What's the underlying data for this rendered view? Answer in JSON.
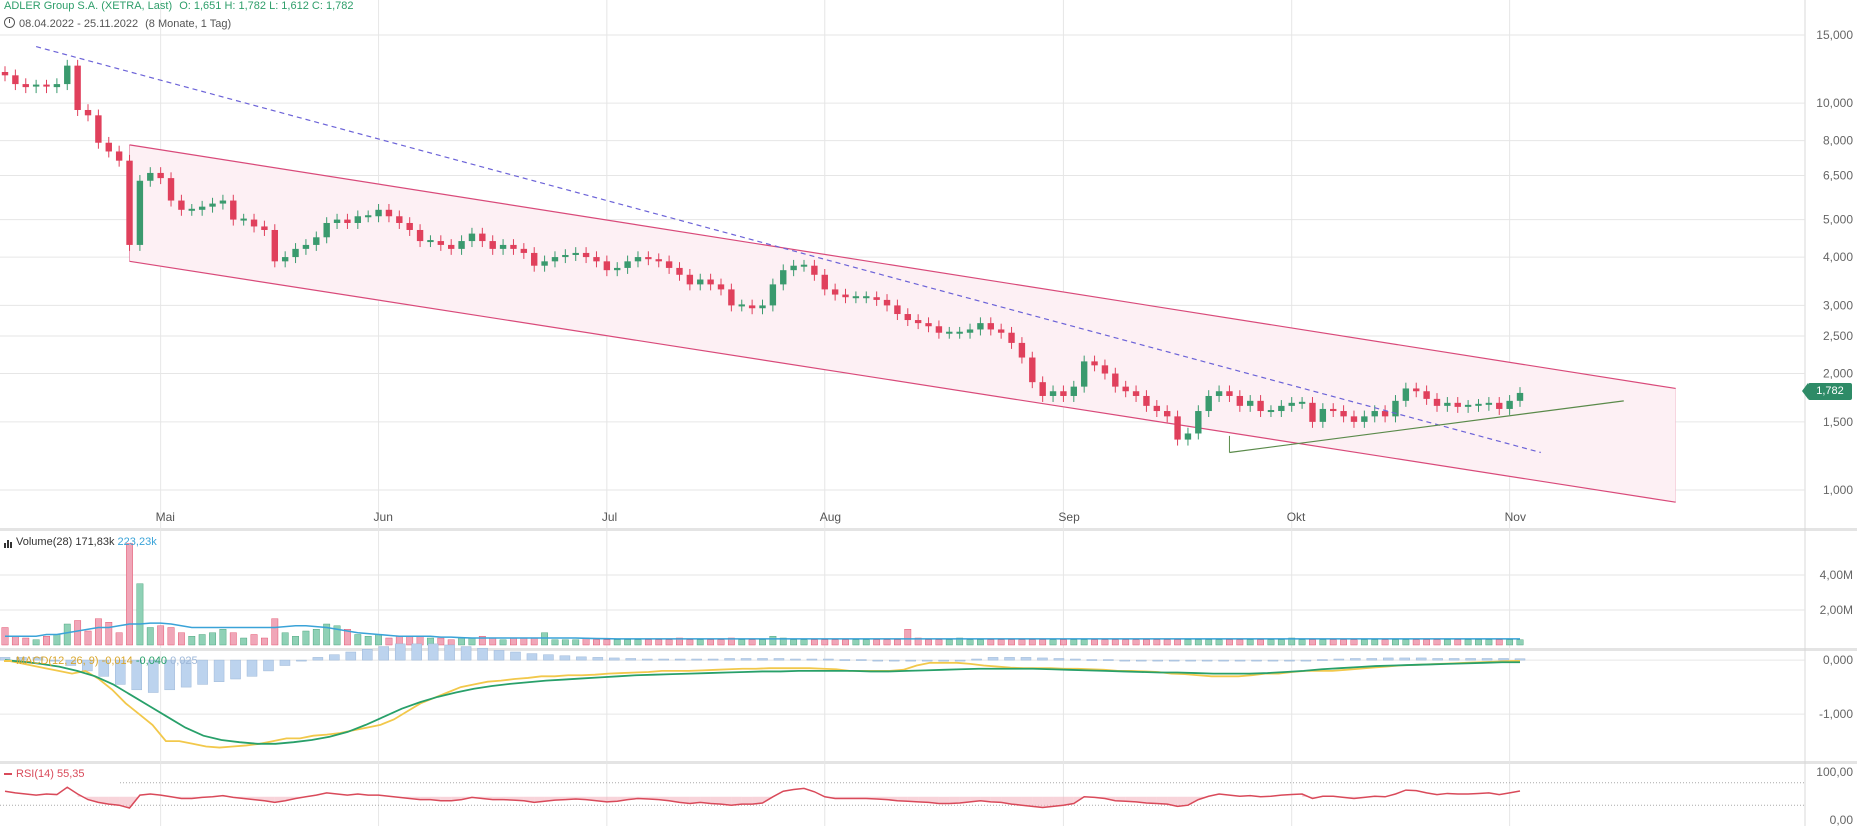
{
  "header": {
    "title": "ADLER Group S.A. (XETRA, Last)",
    "ohlc": "O: 1,651  H: 1,782  L: 1,612  C: 1,782",
    "range": "08.04.2022 - 25.11.2022",
    "duration": "(8 Monate, 1 Tag)"
  },
  "last_price_label": "1,782",
  "panels": {
    "volume": {
      "label": "Volume(28)",
      "v1": "171,83k",
      "v2": "223,23k",
      "ticks": [
        "4,00M",
        "2,00M"
      ]
    },
    "macd": {
      "label": "MACD(12, 26, 9)",
      "v1": "-0,014",
      "v2": "-0,040",
      "v3": "0,025",
      "ticks": [
        "0,000",
        "-1,000"
      ]
    },
    "rsi": {
      "label": "RSI(14)",
      "v1": "55,35",
      "ticks": [
        "100,00",
        "0,00"
      ]
    }
  },
  "chart_data": {
    "type": "candlestick",
    "scale": "log",
    "price_ticks": [
      15,
      10,
      8,
      6.5,
      5,
      4,
      3,
      2.5,
      2,
      1.5,
      1
    ],
    "price_tick_labels": [
      "15,000",
      "10,000",
      "8,000",
      "6,500",
      "5,000",
      "4,000",
      "3,000",
      "2,500",
      "2,000",
      "1,500",
      "1,000"
    ],
    "months": [
      "Mai",
      "Jun",
      "Jul",
      "Aug",
      "Sep",
      "Okt",
      "Nov"
    ],
    "month_start_index": [
      15,
      36,
      58,
      79,
      102,
      124,
      145
    ],
    "close": [
      11.8,
      11.2,
      11.0,
      11.1,
      11.0,
      11.2,
      12.5,
      9.6,
      9.3,
      7.9,
      7.5,
      7.1,
      4.3,
      6.3,
      6.6,
      6.4,
      5.6,
      5.3,
      5.3,
      5.4,
      5.5,
      5.6,
      5.0,
      5.0,
      4.8,
      4.7,
      3.9,
      4.0,
      4.2,
      4.3,
      4.5,
      4.9,
      5.0,
      4.9,
      5.1,
      5.1,
      5.3,
      5.1,
      4.9,
      4.7,
      4.4,
      4.4,
      4.3,
      4.2,
      4.4,
      4.6,
      4.4,
      4.2,
      4.3,
      4.2,
      4.1,
      3.8,
      3.9,
      4.0,
      4.05,
      4.1,
      4.0,
      3.9,
      3.7,
      3.75,
      3.9,
      4.0,
      3.95,
      3.9,
      3.75,
      3.6,
      3.4,
      3.5,
      3.4,
      3.3,
      3.0,
      3.0,
      2.95,
      3.0,
      3.4,
      3.7,
      3.8,
      3.8,
      3.6,
      3.3,
      3.2,
      3.15,
      3.15,
      3.15,
      3.1,
      3.0,
      2.85,
      2.75,
      2.7,
      2.65,
      2.55,
      2.55,
      2.55,
      2.6,
      2.7,
      2.6,
      2.55,
      2.4,
      2.2,
      1.9,
      1.75,
      1.8,
      1.75,
      1.85,
      2.15,
      2.1,
      2.0,
      1.85,
      1.8,
      1.75,
      1.65,
      1.6,
      1.55,
      1.35,
      1.4,
      1.6,
      1.75,
      1.8,
      1.75,
      1.65,
      1.7,
      1.6,
      1.6,
      1.65,
      1.68,
      1.68,
      1.5,
      1.62,
      1.6,
      1.55,
      1.5,
      1.55,
      1.6,
      1.55,
      1.7,
      1.83,
      1.8,
      1.72,
      1.65,
      1.68,
      1.64,
      1.65,
      1.66,
      1.68,
      1.62,
      1.7,
      1.782
    ],
    "volume": [
      1.0,
      0.5,
      0.4,
      0.3,
      0.5,
      0.6,
      1.2,
      1.4,
      0.8,
      1.5,
      1.3,
      0.7,
      5.8,
      3.5,
      1.0,
      1.1,
      1.0,
      0.7,
      0.5,
      0.6,
      0.7,
      0.9,
      0.7,
      0.4,
      0.6,
      0.4,
      1.5,
      0.7,
      0.5,
      0.8,
      0.9,
      1.2,
      1.1,
      0.9,
      0.6,
      0.5,
      0.6,
      0.4,
      0.5,
      0.5,
      0.5,
      0.4,
      0.4,
      0.3,
      0.4,
      0.4,
      0.5,
      0.4,
      0.3,
      0.4,
      0.4,
      0.4,
      0.7,
      0.3,
      0.3,
      0.3,
      0.4,
      0.3,
      0.3,
      0.3,
      0.3,
      0.3,
      0.3,
      0.3,
      0.3,
      0.4,
      0.3,
      0.3,
      0.3,
      0.3,
      0.4,
      0.3,
      0.3,
      0.3,
      0.5,
      0.4,
      0.3,
      0.3,
      0.3,
      0.3,
      0.3,
      0.3,
      0.3,
      0.3,
      0.3,
      0.3,
      0.3,
      0.9,
      0.4,
      0.3,
      0.3,
      0.3,
      0.4,
      0.3,
      0.3,
      0.3,
      0.3,
      0.3,
      0.3,
      0.3,
      0.3,
      0.3,
      0.3,
      0.3,
      0.3,
      0.3,
      0.3,
      0.3,
      0.3,
      0.3,
      0.3,
      0.3,
      0.3,
      0.3,
      0.3,
      0.3,
      0.3,
      0.3,
      0.3,
      0.3,
      0.3,
      0.3,
      0.3,
      0.3,
      0.4,
      0.3,
      0.3,
      0.3,
      0.3,
      0.3,
      0.3,
      0.3,
      0.3,
      0.3,
      0.3,
      0.3,
      0.3,
      0.3,
      0.3,
      0.3,
      0.3,
      0.3,
      0.3,
      0.3,
      0.3,
      0.3,
      0.3,
      0.3,
      0.3,
      0.3,
      0.3,
      0.3,
      0.3,
      0.3,
      0.3,
      0.3,
      0.3,
      0.3,
      0.3,
      0.3,
      0.3,
      0.3,
      0.3,
      0.3,
      0.3,
      0.3,
      0.3,
      0.3,
      0.3,
      0.3,
      0.3,
      0.3,
      0.3,
      0.3,
      0.3,
      0.3,
      0.3,
      0.3,
      0.3,
      0.3,
      0.3,
      0.3,
      0.3,
      0.3,
      0.6,
      0.5,
      0.3
    ],
    "volume_ma": [
      0.5,
      0.5,
      0.5,
      0.5,
      0.6,
      0.6,
      0.7,
      0.8,
      0.9,
      1.0,
      1.0,
      1.1,
      1.2,
      1.2,
      1.25,
      1.25,
      1.2,
      1.1,
      1.0,
      1.0,
      1.0,
      1.0,
      1.0,
      1.0,
      1.0,
      1.0,
      1.0,
      1.05,
      1.1,
      1.1,
      1.05,
      1.0,
      0.9,
      0.8,
      0.7,
      0.65,
      0.6,
      0.55,
      0.5,
      0.5,
      0.5,
      0.5,
      0.45,
      0.45,
      0.42,
      0.4,
      0.4,
      0.4,
      0.4,
      0.4,
      0.4,
      0.4,
      0.4,
      0.4,
      0.4,
      0.4,
      0.38,
      0.37,
      0.36,
      0.35,
      0.35,
      0.35,
      0.35,
      0.35,
      0.35,
      0.35,
      0.35,
      0.35,
      0.35,
      0.35,
      0.35,
      0.35,
      0.35,
      0.35,
      0.35,
      0.35,
      0.35,
      0.35,
      0.35,
      0.35,
      0.35,
      0.35,
      0.35,
      0.35,
      0.35,
      0.35,
      0.35,
      0.35,
      0.35,
      0.35,
      0.35,
      0.35,
      0.35,
      0.35,
      0.35,
      0.35,
      0.35,
      0.35,
      0.35,
      0.35,
      0.35,
      0.35,
      0.35,
      0.35,
      0.35,
      0.35,
      0.35,
      0.35,
      0.35,
      0.35,
      0.35,
      0.35,
      0.35,
      0.35,
      0.35,
      0.35,
      0.35,
      0.35,
      0.35,
      0.35,
      0.35,
      0.35,
      0.35,
      0.35,
      0.35,
      0.35,
      0.35,
      0.35,
      0.35,
      0.35,
      0.35,
      0.35,
      0.35,
      0.35,
      0.35,
      0.35,
      0.35,
      0.35,
      0.35,
      0.35,
      0.35,
      0.35,
      0.35,
      0.35,
      0.35,
      0.35,
      0.35,
      0.35,
      0.35,
      0.35,
      0.35,
      0.35,
      0.35,
      0.35,
      0.35,
      0.35,
      0.35,
      0.35,
      0.35,
      0.35,
      0.35,
      0.35,
      0.35,
      0.35,
      0.35,
      0.35,
      0.35,
      0.35,
      0.35,
      0.35,
      0.35,
      0.35,
      0.35,
      0.35,
      0.35,
      0.35,
      0.35,
      0.35,
      0.35,
      0.35,
      0.35,
      0.35,
      0.35,
      0.35,
      0.35,
      0.35
    ],
    "macd_line": [
      0.0,
      -0.05,
      -0.1,
      -0.15,
      -0.2,
      -0.25,
      -0.2,
      -0.35,
      -0.55,
      -0.8,
      -1.0,
      -1.2,
      -1.5,
      -1.5,
      -1.55,
      -1.6,
      -1.62,
      -1.6,
      -1.58,
      -1.55,
      -1.5,
      -1.45,
      -1.45,
      -1.4,
      -1.38,
      -1.35,
      -1.3,
      -1.25,
      -1.2,
      -1.1,
      -0.95,
      -0.8,
      -0.7,
      -0.6,
      -0.5,
      -0.45,
      -0.4,
      -0.38,
      -0.35,
      -0.33,
      -0.3,
      -0.3,
      -0.28,
      -0.28,
      -0.27,
      -0.25,
      -0.24,
      -0.23,
      -0.22,
      -0.2,
      -0.2,
      -0.2,
      -0.19,
      -0.18,
      -0.17,
      -0.16,
      -0.16,
      -0.15,
      -0.15,
      -0.15,
      -0.15,
      -0.16,
      -0.17,
      -0.2,
      -0.2,
      -0.2,
      -0.2,
      -0.18,
      -0.1,
      -0.05,
      -0.05,
      -0.05,
      -0.07,
      -0.1,
      -0.12,
      -0.14,
      -0.15,
      -0.15,
      -0.15,
      -0.16,
      -0.16,
      -0.17,
      -0.18,
      -0.2,
      -0.2,
      -0.21,
      -0.22,
      -0.25,
      -0.26,
      -0.28,
      -0.3,
      -0.3,
      -0.3,
      -0.28,
      -0.25,
      -0.25,
      -0.22,
      -0.2,
      -0.2,
      -0.2,
      -0.18,
      -0.16,
      -0.14,
      -0.12,
      -0.1,
      -0.09,
      -0.08,
      -0.07,
      -0.06,
      -0.05,
      -0.04,
      -0.03,
      -0.02,
      -0.014
    ],
    "macd_signal": [
      0.0,
      -0.03,
      -0.07,
      -0.12,
      -0.2,
      -0.3,
      -0.45,
      -0.65,
      -0.85,
      -1.05,
      -1.25,
      -1.4,
      -1.48,
      -1.52,
      -1.55,
      -1.55,
      -1.52,
      -1.48,
      -1.42,
      -1.33,
      -1.2,
      -1.05,
      -0.9,
      -0.78,
      -0.68,
      -0.6,
      -0.53,
      -0.48,
      -0.44,
      -0.41,
      -0.38,
      -0.36,
      -0.34,
      -0.32,
      -0.3,
      -0.28,
      -0.27,
      -0.26,
      -0.25,
      -0.24,
      -0.23,
      -0.22,
      -0.21,
      -0.21,
      -0.2,
      -0.2,
      -0.2,
      -0.2,
      -0.21,
      -0.21,
      -0.2,
      -0.19,
      -0.18,
      -0.17,
      -0.16,
      -0.16,
      -0.16,
      -0.16,
      -0.17,
      -0.18,
      -0.19,
      -0.2,
      -0.21,
      -0.22,
      -0.23,
      -0.23,
      -0.24,
      -0.25,
      -0.25,
      -0.25,
      -0.24,
      -0.22,
      -0.2,
      -0.17,
      -0.15,
      -0.13,
      -0.11,
      -0.1,
      -0.09,
      -0.08,
      -0.07,
      -0.06,
      -0.05,
      -0.04,
      -0.04
    ],
    "macd_histogram": [
      0.05,
      0.05,
      0.05,
      0.0,
      -0.1,
      -0.2,
      -0.3,
      -0.45,
      -0.55,
      -0.6,
      -0.55,
      -0.5,
      -0.45,
      -0.4,
      -0.35,
      -0.3,
      -0.2,
      -0.1,
      0.0,
      0.05,
      0.1,
      0.15,
      0.2,
      0.25,
      0.3,
      0.3,
      0.3,
      0.28,
      0.25,
      0.22,
      0.18,
      0.15,
      0.12,
      0.1,
      0.08,
      0.06,
      0.05,
      0.04,
      0.03,
      0.02,
      0.02,
      0.02,
      0.02,
      0.02,
      0.03,
      0.03,
      0.03,
      0.03,
      0.02,
      0.02,
      0.02,
      0.01,
      0.01,
      0.0,
      0.0,
      0.0,
      0.0,
      0.0,
      0.0,
      0.02,
      0.05,
      0.05,
      0.05,
      0.04,
      0.03,
      0.02,
      0.01,
      0.01,
      0.0,
      0.0,
      0.0,
      0.0,
      -0.01,
      -0.01,
      -0.01,
      -0.01,
      -0.01,
      0.0,
      0.0,
      0.0,
      0.01,
      0.02,
      0.03,
      0.03,
      0.04,
      0.04,
      0.04,
      0.03,
      0.03,
      0.03,
      0.03,
      0.03,
      0.025
    ],
    "rsi": [
      55,
      52,
      50,
      48,
      50,
      49,
      62,
      50,
      40,
      35,
      32,
      30,
      25,
      48,
      50,
      48,
      45,
      42,
      42,
      44,
      45,
      47,
      44,
      42,
      40,
      38,
      35,
      38,
      42,
      45,
      48,
      52,
      50,
      48,
      50,
      48,
      48,
      46,
      44,
      42,
      40,
      40,
      38,
      38,
      40,
      44,
      42,
      40,
      40,
      39,
      38,
      35,
      37,
      39,
      40,
      41,
      40,
      38,
      36,
      37,
      40,
      42,
      41,
      40,
      38,
      35,
      33,
      35,
      33,
      32,
      30,
      32,
      32,
      34,
      45,
      55,
      58,
      60,
      54,
      45,
      42,
      42,
      42,
      42,
      41,
      40,
      38,
      37,
      36,
      35,
      33,
      33,
      34,
      36,
      38,
      36,
      35,
      32,
      30,
      28,
      26,
      28,
      30,
      33,
      45,
      44,
      42,
      38,
      37,
      36,
      34,
      33,
      32,
      28,
      30,
      40,
      46,
      50,
      48,
      46,
      47,
      45,
      46,
      48,
      49,
      50,
      42,
      46,
      46,
      44,
      42,
      44,
      46,
      45,
      50,
      57,
      56,
      52,
      49,
      51,
      50,
      50,
      51,
      52,
      49,
      52,
      55.35
    ],
    "trendlines": {
      "dashed_resistance": [
        [
          3,
          14.0
        ],
        [
          148,
          1.25
        ]
      ],
      "channel_upper": [
        [
          12,
          7.8
        ],
        [
          161,
          1.83
        ]
      ],
      "channel_lower": [
        [
          12,
          3.9
        ],
        [
          161,
          0.93
        ]
      ],
      "support": [
        [
          118,
          1.25
        ],
        [
          156,
          1.7
        ]
      ]
    }
  },
  "colors": {
    "up": "#3a9a6e",
    "down": "#e0405c",
    "channel": "#d94a7a",
    "channel_fill": "#fdf0f4",
    "dashed": "#6c63d8",
    "support": "#5a8a4a",
    "volume_ma": "#3aa3d8",
    "macd_line": "#f2c84b",
    "macd_signal": "#28a06a",
    "macd_hist": "#bcd3ee",
    "rsi": "#d94a5a",
    "grid": "#e6e6e6",
    "axis_text": "#666666"
  }
}
